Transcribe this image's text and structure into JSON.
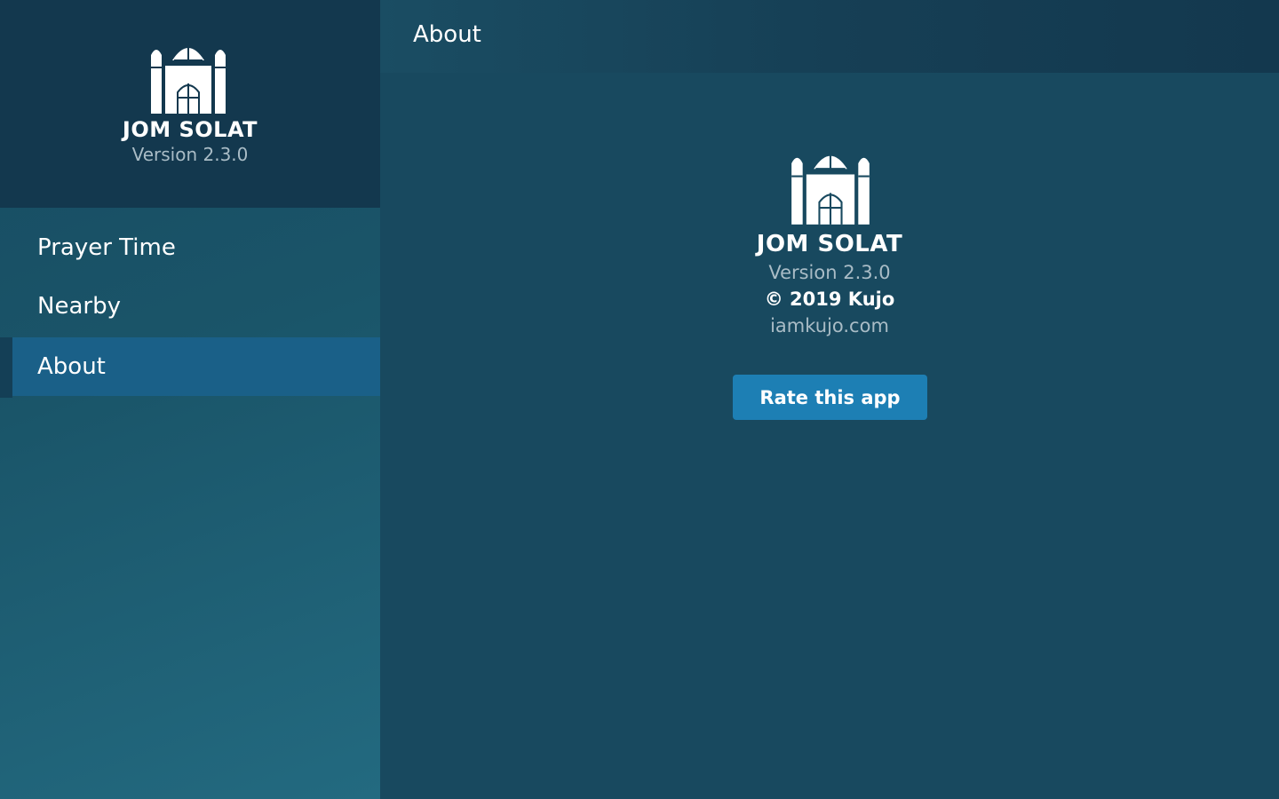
{
  "app": {
    "name": "JOM SOLAT",
    "version": "Version 2.3.0"
  },
  "sidebar": {
    "items": [
      {
        "label": "Prayer Time",
        "active": false
      },
      {
        "label": "Nearby",
        "active": false
      },
      {
        "label": "About",
        "active": true
      }
    ]
  },
  "topbar": {
    "title": "About"
  },
  "about": {
    "name": "JOM SOLAT",
    "version": "Version 2.3.0",
    "copyright": "© 2019 Kujo",
    "website": "iamkujo.com",
    "rate_label": "Rate this app"
  },
  "icons": {
    "logo": "mosque-icon"
  },
  "colors": {
    "accent": "#1d7fb4",
    "active_nav": "#1a6088",
    "background": "#18495f",
    "header": "#13384e"
  }
}
